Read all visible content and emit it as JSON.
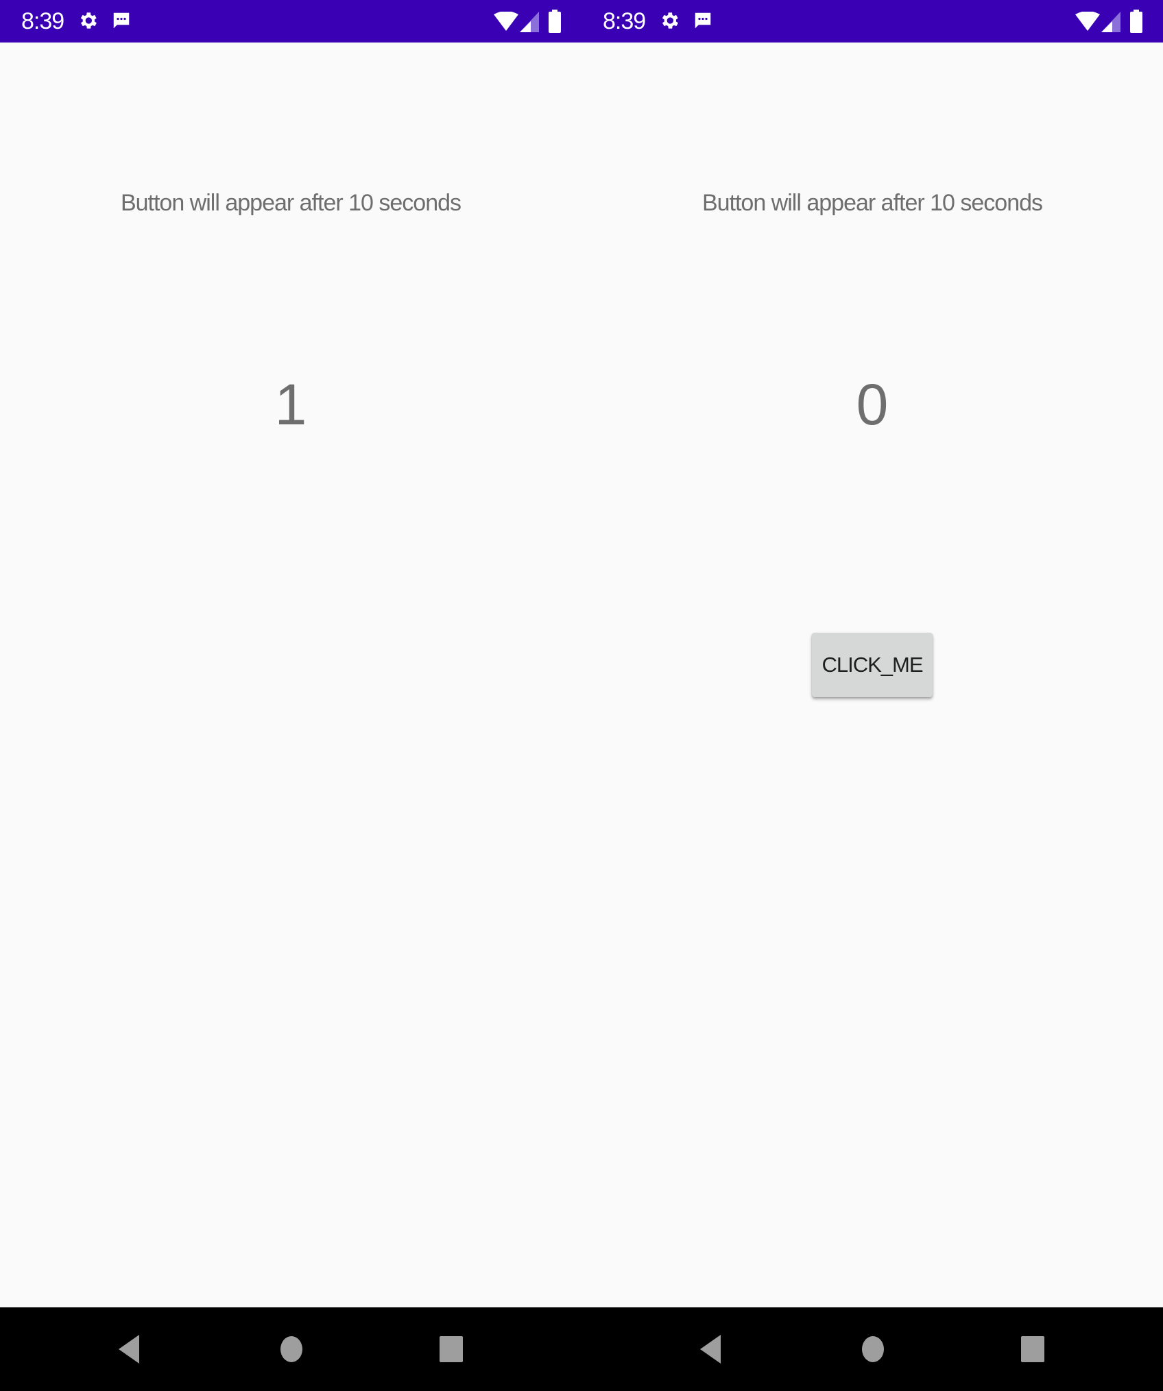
{
  "phones": [
    {
      "status_bar": {
        "time": "8:39",
        "icons": [
          "settings-gear-icon",
          "message-icon",
          "wifi-icon",
          "cell-signal-icon",
          "battery-icon"
        ]
      },
      "prompt": "Button will appear after 10 seconds",
      "counter": "1",
      "button": null
    },
    {
      "status_bar": {
        "time": "8:39",
        "icons": [
          "settings-gear-icon",
          "message-icon",
          "wifi-icon",
          "cell-signal-icon",
          "battery-icon"
        ]
      },
      "prompt": "Button will appear after 10 seconds",
      "counter": "0",
      "button": {
        "label": "CLICK_ME"
      }
    }
  ],
  "nav_bar": {
    "buttons": [
      "back-icon",
      "home-icon",
      "recents-icon"
    ]
  },
  "colors": {
    "status_bar": "#3a00b4",
    "background": "#fafafa",
    "text": "#6e6e6e",
    "button": "#d6d7d7",
    "nav_bar": "#000000"
  }
}
